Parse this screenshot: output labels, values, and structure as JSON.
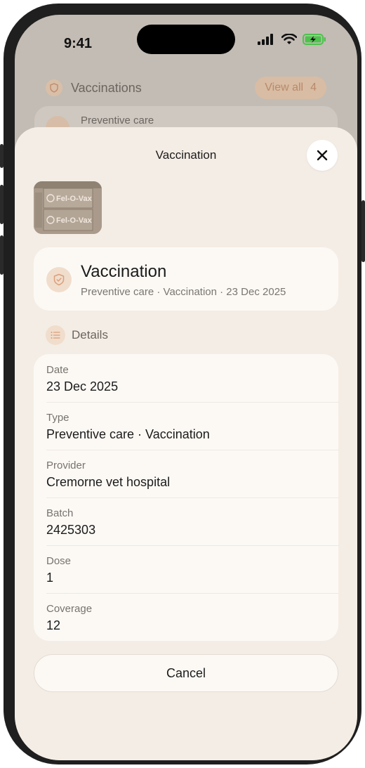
{
  "status_bar": {
    "time": "9:41"
  },
  "background": {
    "section_title": "Vaccinations",
    "view_all_label": "View all",
    "view_all_count": "4",
    "card_label": "Preventive care"
  },
  "sheet": {
    "title": "Vaccination",
    "summary": {
      "title": "Vaccination",
      "subtitle": "Preventive care · Vaccination · 23 Dec 2025"
    },
    "details_heading": "Details",
    "details": [
      {
        "label": "Date",
        "value": "23 Dec 2025"
      },
      {
        "label": "Type",
        "value": "Preventive care · Vaccination"
      },
      {
        "label": "Provider",
        "value": "Cremorne vet hospital"
      },
      {
        "label": "Batch",
        "value": "2425303"
      },
      {
        "label": "Dose",
        "value": "1"
      },
      {
        "label": "Coverage",
        "value": "12"
      }
    ],
    "thumbnail_text": [
      "Fel-O-Vax",
      "Fel-O-Vax"
    ],
    "cancel_label": "Cancel"
  },
  "colors": {
    "accent": "#e0a98a",
    "sheet_bg": "#f4ede5",
    "card_bg": "#fcf9f5"
  },
  "icons": {
    "close": "close-icon",
    "shield": "shield-icon",
    "list": "list-icon"
  }
}
